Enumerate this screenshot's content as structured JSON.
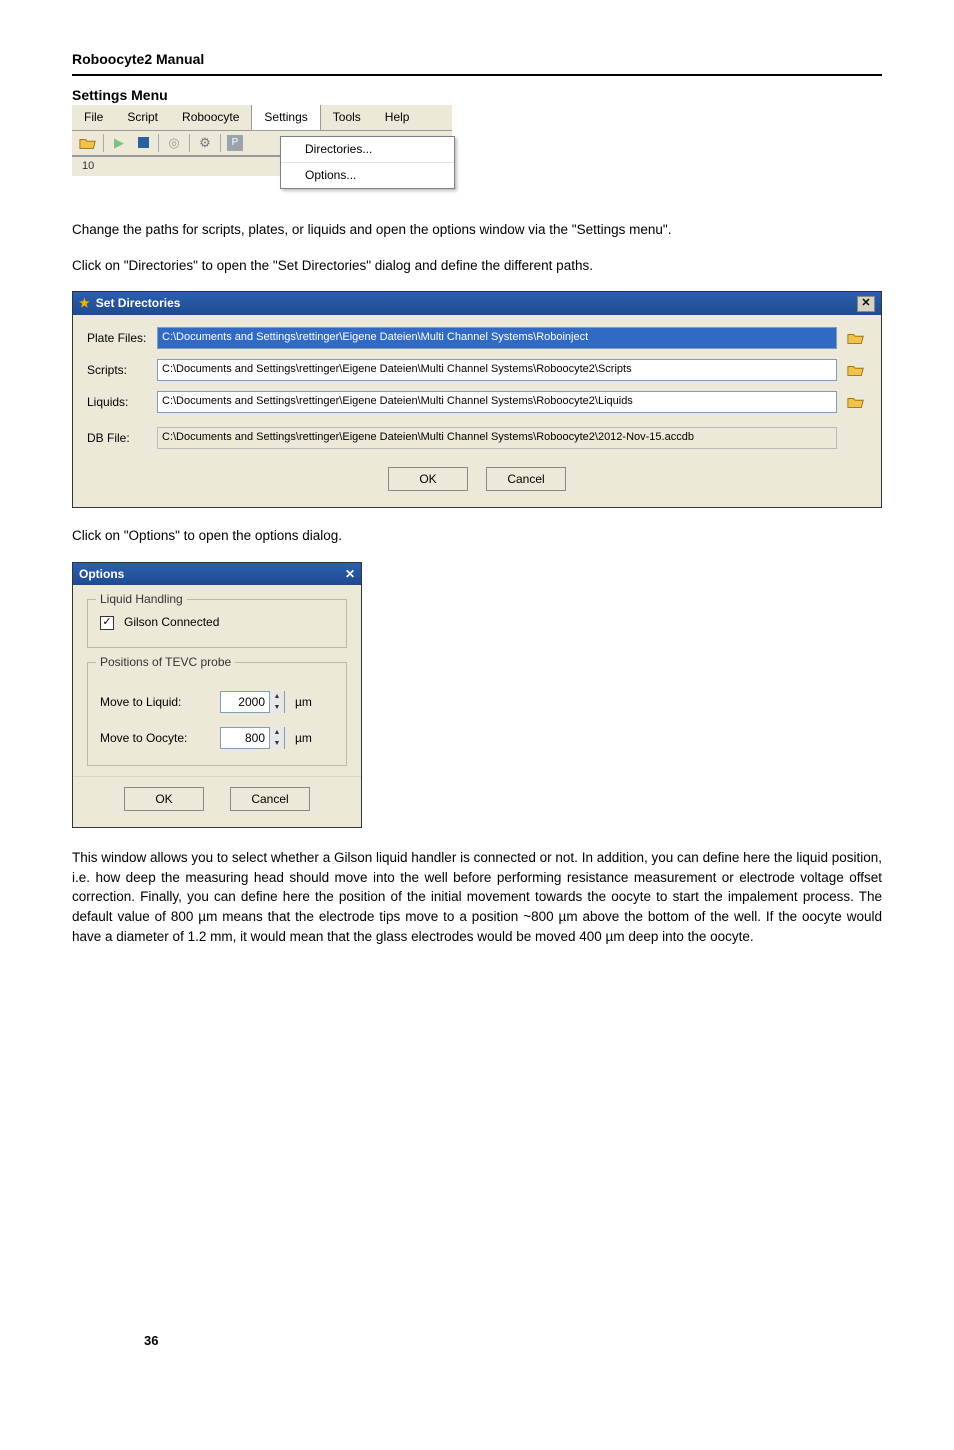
{
  "doc_title": "Roboocyte2  Manual",
  "section_title": "Settings Menu",
  "menubar": {
    "items": [
      "File",
      "Script",
      "Roboocyte",
      "Settings",
      "Tools",
      "Help"
    ],
    "open_index": 3,
    "dropdown": [
      "Directories...",
      "Options..."
    ],
    "chart_fragment": "10"
  },
  "para1": "Change the paths for scripts, plates, or liquids and open the options window via the \"Settings menu\".",
  "para2": "Click on \"Directories\" to open the \"Set Directories\" dialog and define the different paths.",
  "set_directories": {
    "title": "Set Directories",
    "rows": [
      {
        "label": "Plate Files:",
        "value": "C:\\Documents and Settings\\rettinger\\Eigene Dateien\\Multi Channel Systems\\Roboinject",
        "selected": true,
        "browse": true
      },
      {
        "label": "Scripts:",
        "value": "C:\\Documents and Settings\\rettinger\\Eigene Dateien\\Multi Channel Systems\\Roboocyte2\\Scripts",
        "selected": false,
        "browse": true
      },
      {
        "label": "Liquids:",
        "value": "C:\\Documents and Settings\\rettinger\\Eigene Dateien\\Multi Channel Systems\\Roboocyte2\\Liquids",
        "selected": false,
        "browse": true
      },
      {
        "label": "DB File:",
        "value": "C:\\Documents and Settings\\rettinger\\Eigene Dateien\\Multi Channel Systems\\Roboocyte2\\2012-Nov-15.accdb",
        "selected": false,
        "browse": false
      }
    ],
    "ok": "OK",
    "cancel": "Cancel"
  },
  "para3": " Click on \"Options\" to open the options dialog.",
  "options": {
    "title": "Options",
    "group1_legend": "Liquid Handling",
    "checkbox_label": "Gilson Connected",
    "checkbox_checked": true,
    "group2_legend": "Positions of TEVC probe",
    "rows": [
      {
        "label": "Move to Liquid:",
        "value": "2000",
        "unit": "µm"
      },
      {
        "label": "Move to Oocyte:",
        "value": "800",
        "unit": "µm"
      }
    ],
    "ok": "OK",
    "cancel": "Cancel"
  },
  "para4": "This window allows you to select whether a Gilson liquid handler is connected or not. In addition, you can define here the liquid position, i.e. how deep the measuring head should move into the well before performing resistance measurement or electrode voltage offset correction. Finally, you can define here the position of the initial movement towards the oocyte to start the impalement process. The default value of 800 µm means that the electrode tips move to a position ~800 µm above the bottom of the well. If the oocyte would have a diameter of 1.2 mm, it would mean that the glass electrodes would be moved 400 µm deep into the oocyte.",
  "page_number": "36"
}
